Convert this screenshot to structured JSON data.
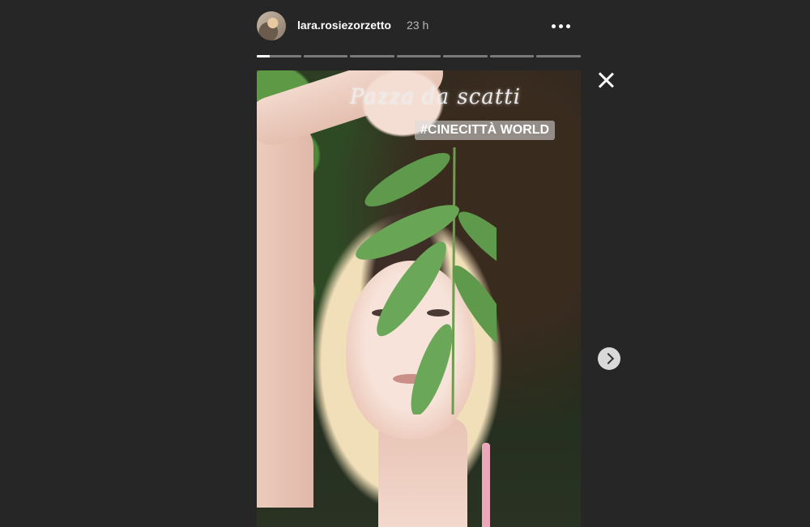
{
  "header": {
    "username": "lara.rosiezorzetto",
    "time": "23 h"
  },
  "progress": {
    "segments": 7,
    "current_index": 0,
    "current_fill": 0.3
  },
  "story": {
    "text_sticker": "Pazza da scatti",
    "hashtag": "#CINECITTÀ WORLD"
  },
  "icons": {
    "more": "more-options-icon",
    "close": "close-icon",
    "next": "chevron-right-icon"
  },
  "colors": {
    "background": "#262626",
    "text": "#ffffff",
    "muted_text": "#b8b8b8"
  }
}
